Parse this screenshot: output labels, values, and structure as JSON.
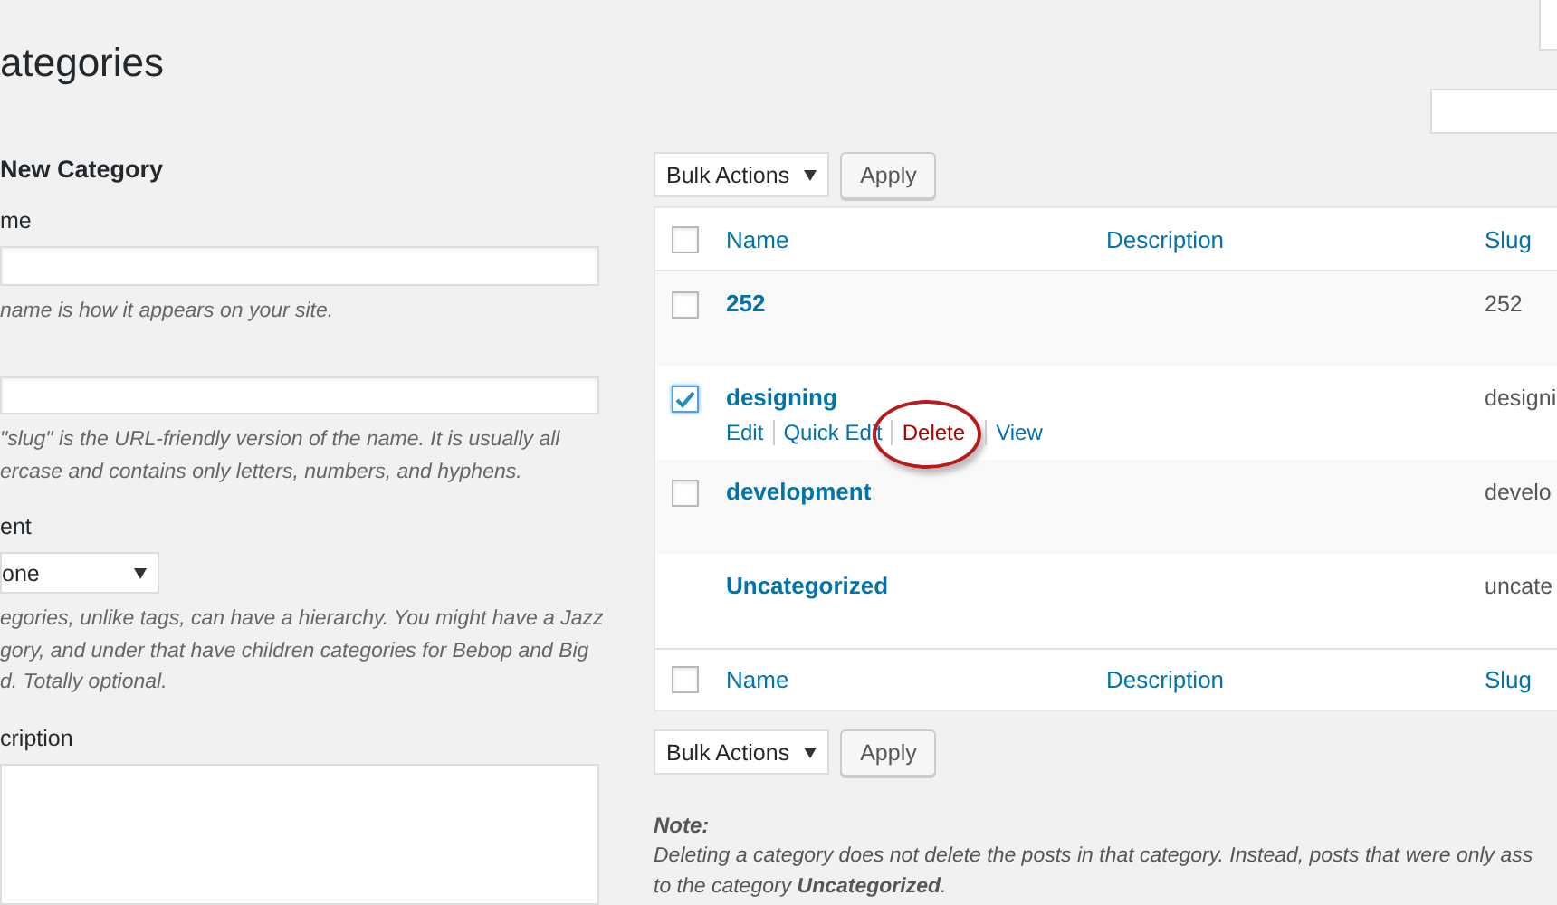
{
  "page_title": "ategories",
  "add_form": {
    "heading": "New Category",
    "fields": [
      {
        "kind": "input",
        "label": "me",
        "help": [
          "name is how it appears on your site."
        ]
      },
      {
        "kind": "input",
        "help": [
          "\"slug\" is the URL-friendly version of the name. It is usually all",
          "ercase and contains only letters, numbers, and hyphens."
        ]
      },
      {
        "kind": "select",
        "label": "ent",
        "value": "one",
        "help": [
          "egories, unlike tags, can have a hierarchy. You might have a Jazz",
          "gory, and under that have children categories for Bebop and Big",
          "d. Totally optional."
        ]
      },
      {
        "kind": "textarea",
        "label": "cription"
      }
    ]
  },
  "bulk_top": {
    "select": "Bulk Actions",
    "button": "Apply"
  },
  "table": {
    "header": {
      "checked": false,
      "columns": [
        "Name",
        "Description",
        "Slug"
      ]
    },
    "footer": {
      "checked": false,
      "columns": [
        "Name",
        "Description",
        "Slug"
      ]
    },
    "rows": [
      {
        "kind": "checkbox",
        "checked": false,
        "name": "252",
        "slug": "252"
      },
      {
        "kind": "checkbox",
        "checked": true,
        "name": "designing",
        "slug": "designi",
        "actions": [
          {
            "label": "Edit",
            "danger": false
          },
          {
            "label": "Quick Edit",
            "danger": false
          },
          {
            "label": "Delete",
            "danger": true,
            "circled": true
          },
          {
            "label": "View",
            "danger": false
          }
        ]
      },
      {
        "kind": "checkbox",
        "checked": false,
        "name": "development",
        "slug": "develo"
      },
      {
        "kind": "plain",
        "name": "Uncategorized",
        "slug": "uncate"
      }
    ]
  },
  "bulk_bottom": {
    "select": "Bulk Actions",
    "button": "Apply"
  },
  "note": {
    "title": "Note:",
    "lines": [
      "Deleting a category does not delete the posts in that category. Instead, posts that were only ass",
      "to the category **Uncategorized**."
    ]
  }
}
